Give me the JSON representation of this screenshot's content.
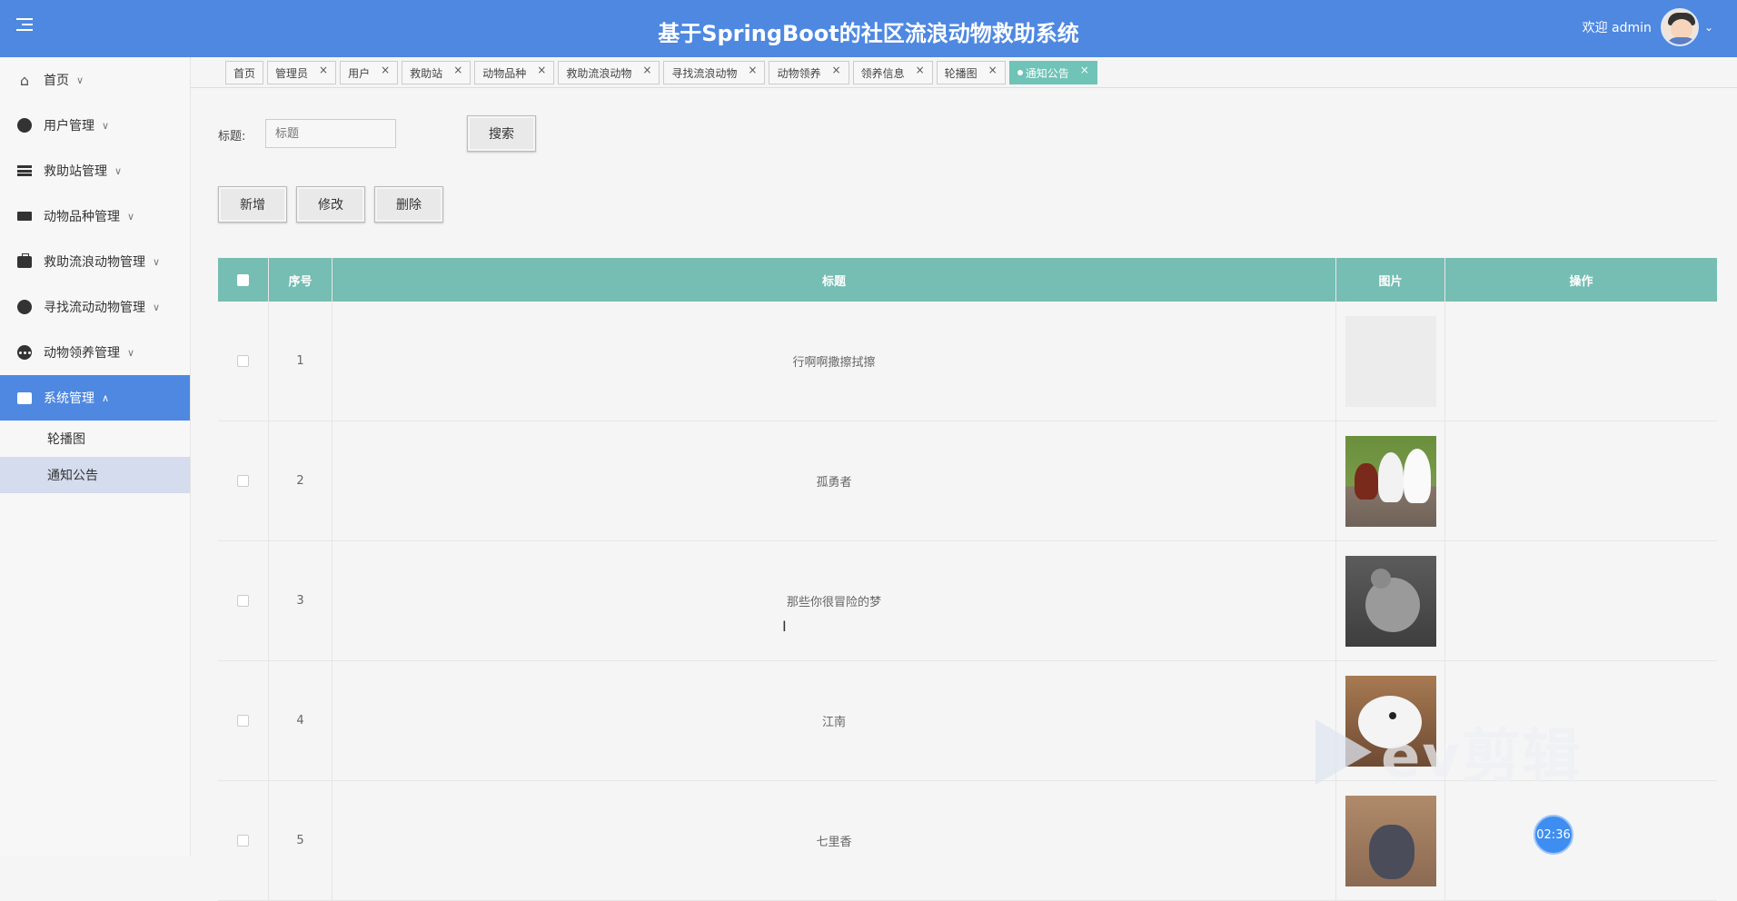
{
  "header": {
    "title": "基于SpringBoot的社区流浪动物救助系统",
    "welcome": "欢迎 admin",
    "menu_icon": "hamburger-icon"
  },
  "sidebar": {
    "items": [
      {
        "label": "首页",
        "icon": "home-icon"
      },
      {
        "label": "用户管理",
        "icon": "gauge-icon"
      },
      {
        "label": "救助站管理",
        "icon": "list-icon"
      },
      {
        "label": "动物品种管理",
        "icon": "card-icon"
      },
      {
        "label": "救助流浪动物管理",
        "icon": "briefcase-icon"
      },
      {
        "label": "寻找流动动物管理",
        "icon": "gauge-icon"
      },
      {
        "label": "动物领养管理",
        "icon": "dots-icon"
      },
      {
        "label": "系统管理",
        "icon": "store-icon"
      }
    ],
    "subitems": [
      "轮播图",
      "通知公告"
    ]
  },
  "tabs": [
    {
      "label": "首页",
      "closable": false
    },
    {
      "label": "管理员",
      "closable": true
    },
    {
      "label": "用户",
      "closable": true
    },
    {
      "label": "救助站",
      "closable": true
    },
    {
      "label": "动物品种",
      "closable": true
    },
    {
      "label": "救助流浪动物",
      "closable": true
    },
    {
      "label": "寻找流浪动物",
      "closable": true
    },
    {
      "label": "动物领养",
      "closable": true
    },
    {
      "label": "领养信息",
      "closable": true
    },
    {
      "label": "轮播图",
      "closable": true
    },
    {
      "label": "通知公告",
      "closable": true
    }
  ],
  "search": {
    "label": "标题:",
    "placeholder": "标题",
    "button": "搜索"
  },
  "actions": {
    "add": "新增",
    "edit": "修改",
    "delete": "删除"
  },
  "table": {
    "columns": [
      "序号",
      "标题",
      "图片",
      "操作"
    ],
    "rows": [
      {
        "idx": "1",
        "title": "行啊啊撒擦拭擦",
        "image": "empty"
      },
      {
        "idx": "2",
        "title": "孤勇者",
        "image": "dogs"
      },
      {
        "idx": "3",
        "title": "那些你很冒险的梦",
        "image": "chinchilla-gray"
      },
      {
        "idx": "4",
        "title": "江南",
        "image": "chinchilla-white"
      },
      {
        "idx": "5",
        "title": "七里香",
        "image": "chinchilla-dark"
      }
    ]
  },
  "overlay": {
    "watermark": "ev剪辑",
    "timer": "02:36"
  },
  "colors": {
    "header": "#4e88e0",
    "table_header": "#76bdb3",
    "active_tab": "#6fc3b7",
    "sidebar_active": "#4e88e0"
  }
}
